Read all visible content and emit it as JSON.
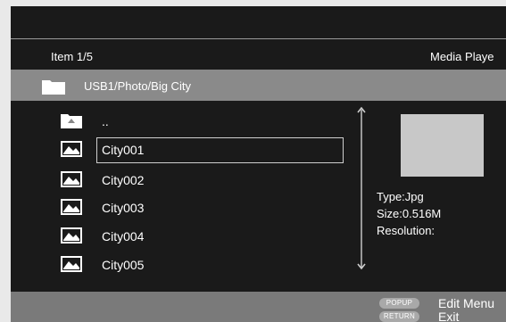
{
  "header": {
    "item_count": "Item 1/5",
    "app_name": "Media Playe"
  },
  "path": {
    "folder_icon": "folder-icon",
    "text": "USB1/Photo/Big City"
  },
  "list": {
    "parent": {
      "icon": "parent-folder-icon",
      "label": ".."
    },
    "items": [
      {
        "icon": "photo-icon",
        "label": "City001",
        "selected": true
      },
      {
        "icon": "photo-icon",
        "label": "City002",
        "selected": false
      },
      {
        "icon": "photo-icon",
        "label": "City003",
        "selected": false
      },
      {
        "icon": "photo-icon",
        "label": "City004",
        "selected": false
      },
      {
        "icon": "photo-icon",
        "label": "City005",
        "selected": false
      }
    ]
  },
  "details": {
    "type": "Type:Jpg",
    "size": "Size:0.516M",
    "resolution": "Resolution:"
  },
  "footer": {
    "hints": [
      {
        "key": "POPUP",
        "action": "Edit Menu"
      },
      {
        "key": "RETURN",
        "action": "Exit"
      }
    ]
  },
  "colors": {
    "screen_bg": "#1a1a1a",
    "path_bar": "#8a8a8a",
    "footer_bar": "#7a7a7a",
    "preview_placeholder": "#c8c8c8",
    "frame_bg": "#e9e9e9"
  }
}
